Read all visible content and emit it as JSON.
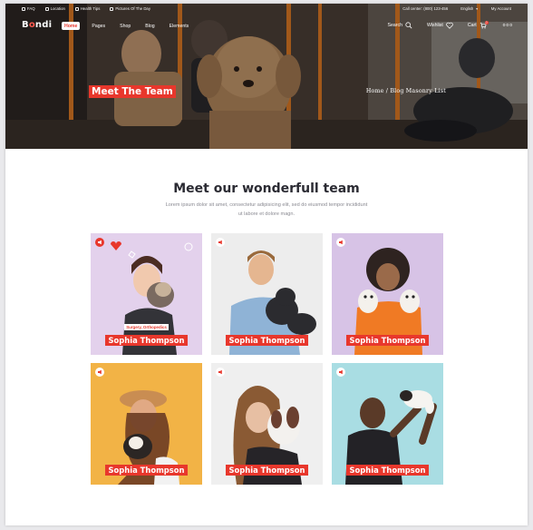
{
  "topbar": {
    "left": [
      {
        "icon": "question-icon",
        "label": "FAQ"
      },
      {
        "icon": "location-pin-icon",
        "label": "Location"
      },
      {
        "icon": "health-icon",
        "label": "Health Tips"
      },
      {
        "icon": "paw-icon",
        "label": "Pictures Of The Day"
      }
    ],
    "call": "Call center: (800) 123-456",
    "language": "English",
    "account": "My Account"
  },
  "nav": {
    "logo_a": "B",
    "logo_o": "o",
    "logo_b": "ndi",
    "menu": [
      {
        "label": "Home",
        "active": true
      },
      {
        "label": "Pages",
        "active": false
      },
      {
        "label": "Shop",
        "active": false
      },
      {
        "label": "Blog",
        "active": false
      },
      {
        "label": "Elements",
        "active": false
      }
    ],
    "search": "Search",
    "wishlist": "Wishlist",
    "cart": "Cart",
    "cart_count": "0",
    "more": "ooo"
  },
  "hero": {
    "title": "Meet The Team",
    "breadcrumb": "Home / Blog Masonry List"
  },
  "section": {
    "title": "Meet our wonderfull team",
    "description": "Lorem ipsum dolor sit amet, consectetur adipisicing elit, sed do eiusmod tempor incididunt ut labore et dolore magn."
  },
  "team": [
    {
      "name": "Sophia Thompson",
      "role": "Surgery, Orthopedics",
      "bg": "#e3d1ec",
      "show_role": true
    },
    {
      "name": "Sophia Thompson",
      "role": "",
      "bg": "#ededed",
      "show_role": false
    },
    {
      "name": "Sophia Thompson",
      "role": "",
      "bg": "#d7c3e6",
      "show_role": false
    },
    {
      "name": "Sophia Thompson",
      "role": "",
      "bg": "#f2b346",
      "show_role": false
    },
    {
      "name": "Sophia Thompson",
      "role": "",
      "bg": "#efefef",
      "show_role": false
    },
    {
      "name": "Sophia Thompson",
      "role": "",
      "bg": "#a9dde3",
      "show_role": false
    }
  ],
  "colors": {
    "accent": "#e8372c",
    "heading": "#2b2b33",
    "muted": "#8a8a92"
  }
}
